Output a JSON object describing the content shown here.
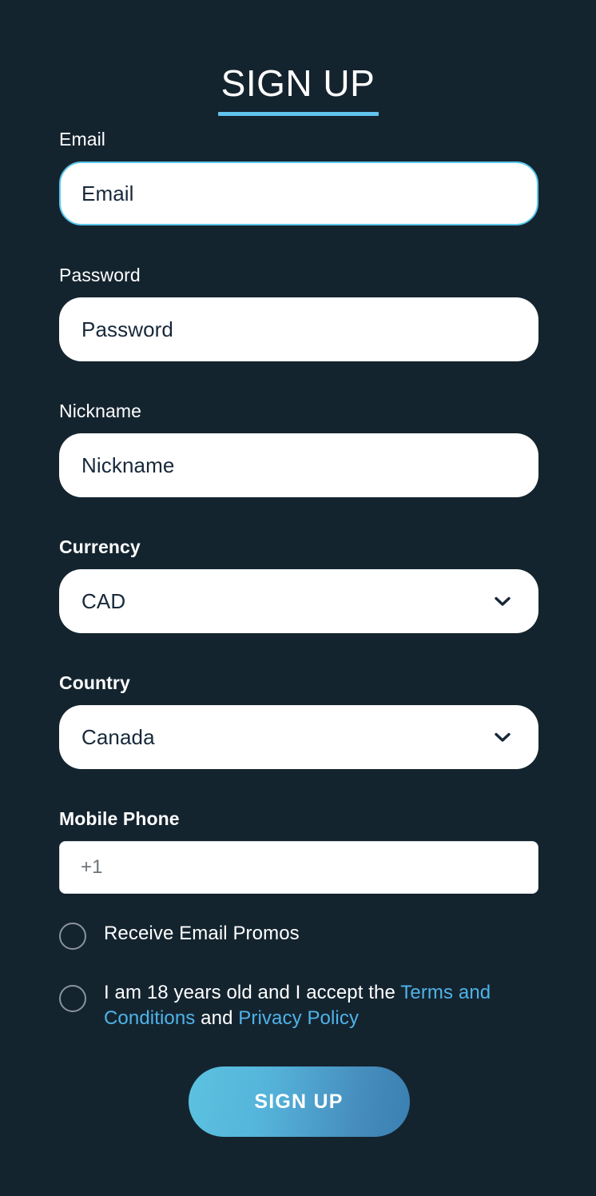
{
  "theme": {
    "background": "#14242f",
    "accent": "#62c4ee",
    "link_color": "#4fb3e8",
    "focus_border": "#5bc8ec",
    "input_background": "#ffffff",
    "input_text": "#17283a",
    "placeholder_muted": "#6d7479",
    "checkbox_ring": "#8a949c",
    "button_gradient_start": "#5cc2e1",
    "button_gradient_end": "#3a7fb0"
  },
  "header": {
    "title": "SIGN UP"
  },
  "form": {
    "email": {
      "label": "Email",
      "placeholder": "Email",
      "value": "Email",
      "focused": true
    },
    "password": {
      "label": "Password",
      "placeholder": "Password",
      "value": "Password",
      "focused": false
    },
    "nickname": {
      "label": "Nickname",
      "placeholder": "Nickname",
      "value": "Nickname",
      "focused": false
    },
    "currency": {
      "label": "Currency",
      "value": "CAD",
      "icon": "chevron-down-icon"
    },
    "country": {
      "label": "Country",
      "value": "Canada",
      "icon": "chevron-down-icon"
    },
    "mobile_phone": {
      "label": "Mobile Phone",
      "placeholder": "+1",
      "value": "+1"
    }
  },
  "consents": {
    "promos": {
      "label": "Receive Email Promos",
      "checked": false
    },
    "terms": {
      "text_before": "I am 18 years old and I accept the ",
      "terms_link": "Terms and Conditions",
      "text_between": " and ",
      "privacy_link": "Privacy Policy",
      "checked": false
    }
  },
  "actions": {
    "submit_label": "SIGN UP"
  }
}
